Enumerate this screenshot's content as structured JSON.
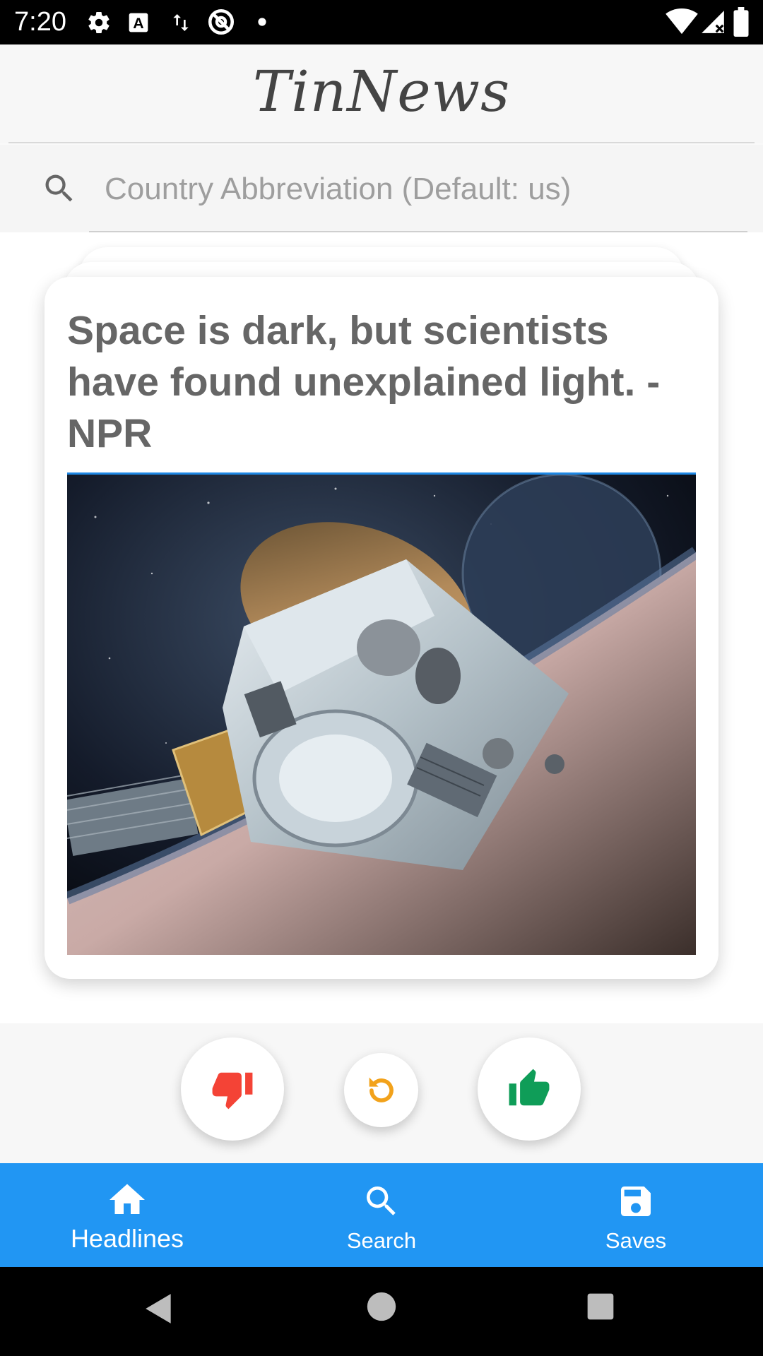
{
  "status_bar": {
    "time": "7:20",
    "icons": [
      "gear-icon",
      "keyboard-a-icon",
      "data-transfer-icon",
      "no-sim-icon",
      "dot-icon",
      "wifi-icon",
      "signal-icon",
      "battery-icon"
    ]
  },
  "app": {
    "title": "TinNews"
  },
  "search": {
    "placeholder": "Country Abbreviation (Default: us)",
    "value": ""
  },
  "card": {
    "title": "Space is dark, but scientists have found unexplained light. - NPR",
    "image": "spacecraft-illustration"
  },
  "actions": {
    "dislike": "thumbs-down-icon",
    "rewind": "rewind-icon",
    "like": "thumbs-up-icon"
  },
  "bottom_nav": {
    "items": [
      {
        "label": "Headlines",
        "icon": "home-icon",
        "active": true
      },
      {
        "label": "Search",
        "icon": "search-icon",
        "active": false
      },
      {
        "label": "Saves",
        "icon": "save-icon",
        "active": false
      }
    ]
  },
  "colors": {
    "primary": "#2196f3",
    "dislike": "#f44336",
    "like": "#0f9d58",
    "rewind": "#f2a21b"
  }
}
